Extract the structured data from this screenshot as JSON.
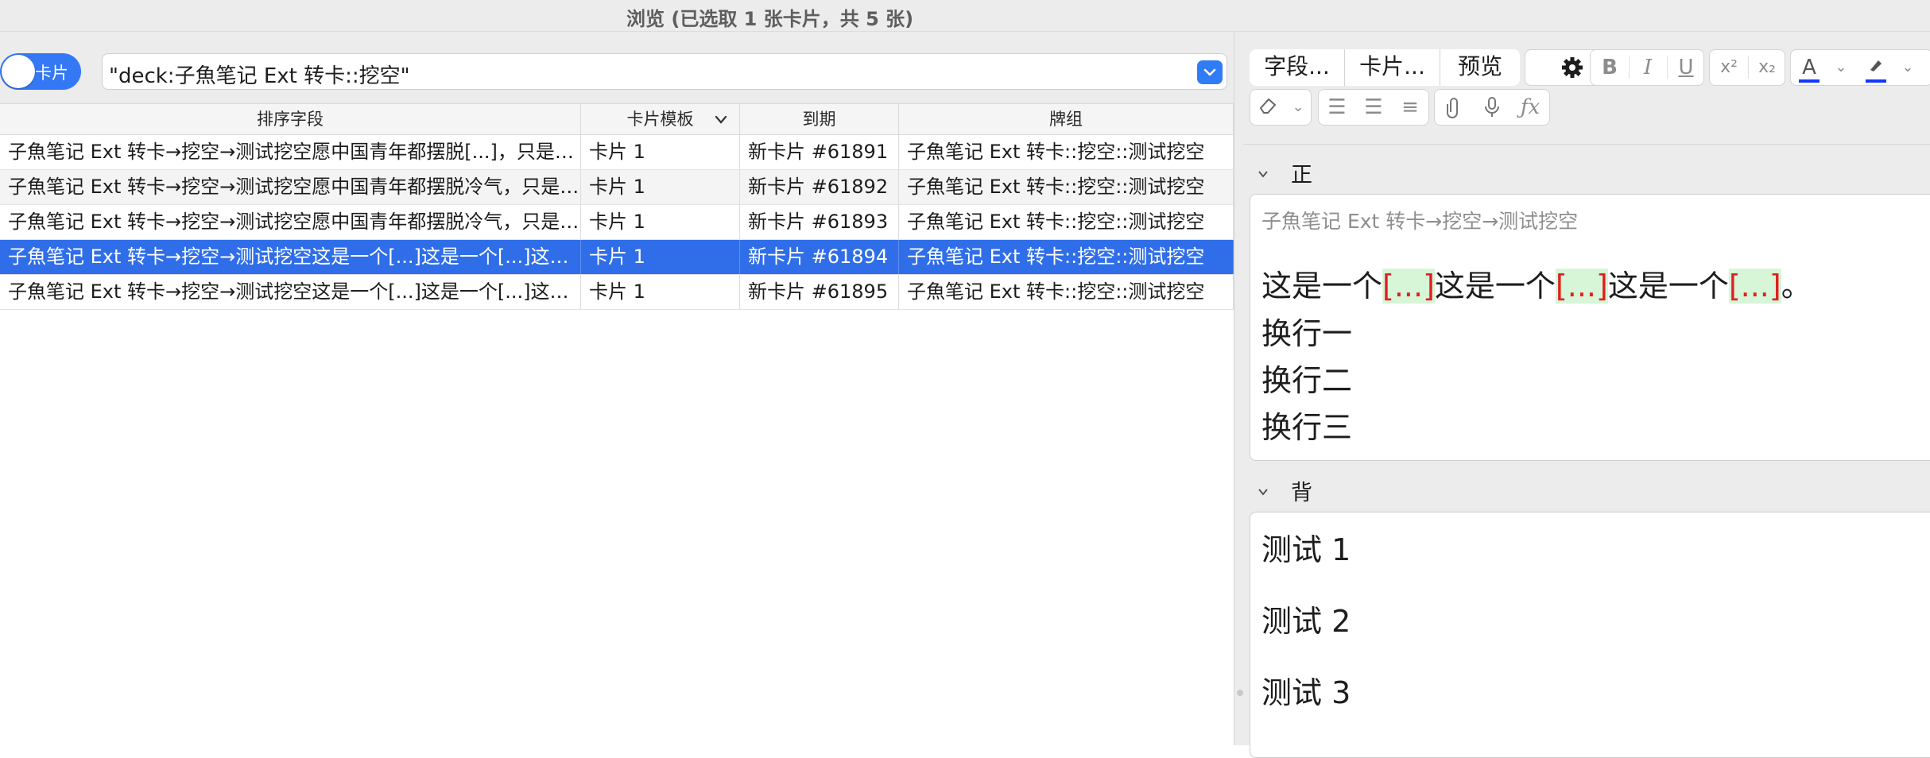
{
  "window": {
    "title": "浏览 (已选取 1 张卡片，共 5 张)"
  },
  "toolbar": {
    "toggle_label": "卡片",
    "search_value": "\"deck:子魚笔记 Ext 转卡::挖空\""
  },
  "table": {
    "columns": [
      "排序字段",
      "卡片模板",
      "到期",
      "牌组"
    ],
    "rows": [
      [
        "子魚笔记 Ext 转卡→挖空→测试挖空愿中国青年都摆脱[...]，只是向上走，不必听自暴自弃者流的话。",
        "卡片 1",
        "新卡片 #61891",
        "子魚笔记 Ext 转卡::挖空::测试挖空"
      ],
      [
        "子魚笔记 Ext 转卡→挖空→测试挖空愿中国青年都摆脱冷气，只是向上走，不必听自暴自弃者流的话。",
        "卡片 1",
        "新卡片 #61892",
        "子魚笔记 Ext 转卡::挖空::测试挖空"
      ],
      [
        "子魚笔记 Ext 转卡→挖空→测试挖空愿中国青年都摆脱冷气，只是向上走，不必听自暴自弃者流的话。",
        "卡片 1",
        "新卡片 #61893",
        "子魚笔记 Ext 转卡::挖空::测试挖空"
      ],
      [
        "子魚笔记 Ext 转卡→挖空→测试挖空这是一个[...]这是一个[...]这是一个[...]。",
        "卡片 1",
        "新卡片 #61894",
        "子魚笔记 Ext 转卡::挖空::测试挖空"
      ],
      [
        "子魚笔记 Ext 转卡→挖空→测试挖空这是一个[...]这是一个[...]这是一个[...]。",
        "卡片 1",
        "新卡片 #61895",
        "子魚笔记 Ext 转卡::挖空::测试挖空"
      ]
    ],
    "selected_index": 3
  },
  "editor": {
    "fields_button": "字段...",
    "cards_button": "卡片...",
    "preview_button": "预览",
    "icons": [
      "gear-icon",
      "bold-icon",
      "italic-icon",
      "underline-icon",
      "superscript-icon",
      "subscript-icon",
      "text-color-icon",
      "highlight-icon",
      "eraser-icon",
      "bullet-list-icon",
      "numbered-list-icon",
      "align-icon",
      "attachment-icon",
      "microphone-icon",
      "formula-icon"
    ],
    "accent_color": "#2f6ee8",
    "front": {
      "label": "正面",
      "hint": "子魚笔记 Ext 转卡→挖空→测试挖空",
      "cloze_segment": "这是一个",
      "cloze_marker": "[...]",
      "cloze_end": "。",
      "lines": [
        "换行一",
        "换行二",
        "换行三"
      ]
    },
    "back": {
      "label": "背面",
      "lines": [
        "测试 1",
        "测试 2",
        "测试 3"
      ]
    }
  }
}
